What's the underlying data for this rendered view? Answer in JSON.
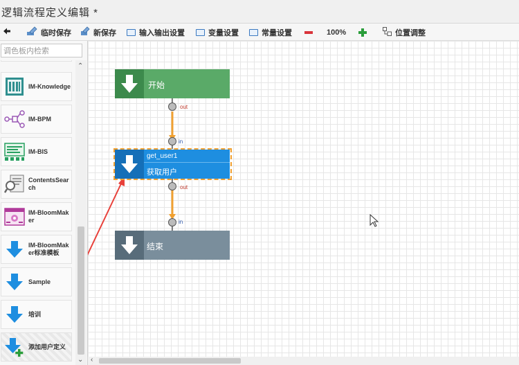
{
  "window": {
    "title": "逻辑流程定义编辑 *"
  },
  "toolbar": {
    "back_icon": "arrow-left-icon",
    "temp_save": "临时保存",
    "new_save": "新保存",
    "io_settings": "输入输出设置",
    "var_settings": "变量设置",
    "const_settings": "常量设置",
    "zoom": "100%",
    "position_adjust": "位置调整"
  },
  "sidebar": {
    "search_placeholder": "调色板内检索",
    "items": [
      {
        "label": "IM-Knowledge",
        "icon": "knowledge-icon"
      },
      {
        "label": "IM-BPM",
        "icon": "bpm-icon"
      },
      {
        "label": "IM-BIS",
        "icon": "bis-icon"
      },
      {
        "label": "ContentsSearch",
        "icon": "contents-search-icon"
      },
      {
        "label": "IM-BloomMaker",
        "icon": "bloommaker-icon"
      },
      {
        "label": "IM-BloomMaker标准模板",
        "icon": "arrow-down-icon"
      },
      {
        "label": "Sample",
        "icon": "arrow-down-icon"
      },
      {
        "label": "培训",
        "icon": "arrow-down-icon"
      },
      {
        "label": "添加用户定义",
        "icon": "add-user-defined-icon"
      }
    ]
  },
  "flow": {
    "start": {
      "label": "开始",
      "color": "#5aaa68"
    },
    "task": {
      "id": "get_user1",
      "label": "获取用户",
      "color": "#1e8ee0"
    },
    "end": {
      "label": "结束",
      "color": "#7a8e9c"
    },
    "port_out": "out",
    "port_in": "in"
  }
}
